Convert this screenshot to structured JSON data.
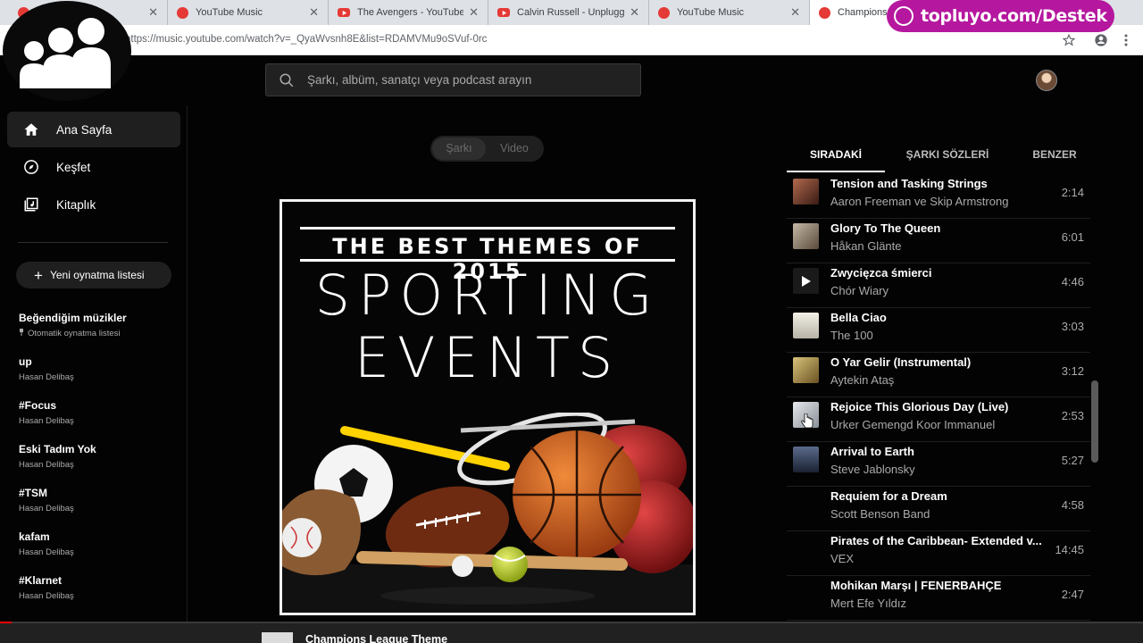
{
  "browser": {
    "tabs": [
      {
        "title": "",
        "icon": "youtube-music"
      },
      {
        "title": "YouTube Music",
        "icon": "youtube-music"
      },
      {
        "title": "The Avengers - YouTube",
        "icon": "youtube"
      },
      {
        "title": "Calvin Russell - Unplugged",
        "icon": "youtube"
      },
      {
        "title": "YouTube Music",
        "icon": "youtube-music"
      },
      {
        "title": "Champions",
        "icon": "youtube-music"
      }
    ],
    "url": "https://music.youtube.com/watch?v=_QyaWvsnh8E&list=RDAMVMu9oSVuf-0rc"
  },
  "overlay": {
    "banner_text": "topluyo.com/Destek"
  },
  "header": {
    "search_placeholder": "Şarkı, albüm, sanatçı veya podcast arayın"
  },
  "sidebar": {
    "nav": [
      {
        "label": "Ana Sayfa",
        "icon": "home-icon",
        "active": true
      },
      {
        "label": "Keşfet",
        "icon": "compass-icon",
        "active": false
      },
      {
        "label": "Kitaplık",
        "icon": "library-icon",
        "active": false
      }
    ],
    "new_playlist_label": "Yeni oynatma listesi",
    "playlists": [
      {
        "title": "Beğendiğim müzikler",
        "subtitle": "Otomatik oynatma listesi",
        "pinned": true
      },
      {
        "title": "up",
        "subtitle": "Hasan Delibaş"
      },
      {
        "title": "#Focus",
        "subtitle": "Hasan Delibaş"
      },
      {
        "title": "Eski Tadım Yok",
        "subtitle": "Hasan Delibaş"
      },
      {
        "title": "#TSM",
        "subtitle": "Hasan Delibaş"
      },
      {
        "title": "kafam",
        "subtitle": "Hasan Delibaş"
      },
      {
        "title": "#Klarnet",
        "subtitle": "Hasan Delibaş"
      }
    ]
  },
  "main": {
    "toggle": {
      "song_label": "Şarkı",
      "video_label": "Video"
    },
    "album_art": {
      "top_text": "THE BEST THEMES OF 2015",
      "line1": "SPORTING",
      "line2": "EVENTS"
    }
  },
  "queue": {
    "tabs": [
      "SIRADAKİ",
      "ŞARKI SÖZLERİ",
      "BENZER"
    ],
    "items": [
      {
        "title": "Tension and Tasking Strings",
        "artist": "Aaron Freeman ve Skip Armstrong",
        "duration": "2:14",
        "thumb": "#7a3a2e"
      },
      {
        "title": "Glory To The Queen",
        "artist": "Håkan Glänte",
        "duration": "6:01",
        "thumb": "#8a7a66"
      },
      {
        "title": "Zwycięzca śmierci",
        "artist": "Chór Wiary",
        "duration": "4:46",
        "thumb": "play"
      },
      {
        "title": "Bella Ciao",
        "artist": "The 100",
        "duration": "3:03",
        "thumb": "#e8e4da"
      },
      {
        "title": "O Yar Gelir (Instrumental)",
        "artist": "Aytekin Ataş",
        "duration": "3:12",
        "thumb": "#a88a4a"
      },
      {
        "title": "Rejoice This Glorious Day (Live)",
        "artist": "Urker Gemengd Koor Immanuel",
        "duration": "2:53",
        "thumb": "#c9cdd2"
      },
      {
        "title": "Arrival to Earth",
        "artist": "Steve Jablonsky",
        "duration": "5:27",
        "thumb": "#3a4a66"
      },
      {
        "title": "Requiem for a Dream",
        "artist": "Scott Benson Band",
        "duration": "4:58",
        "thumb": "none"
      },
      {
        "title": "Pirates of the Caribbean- Extended v...",
        "artist": "VEX",
        "duration": "14:45",
        "thumb": "none"
      },
      {
        "title": "Mohikan Marşı | FENERBAHÇE",
        "artist": "Mert Efe Yıldız",
        "duration": "2:47",
        "thumb": "none"
      }
    ]
  },
  "player": {
    "title": "Champions League Theme",
    "progress_fraction": 0.01
  },
  "colors": {
    "accent": "#ff0000",
    "background": "#030303",
    "overlay_banner": "#b5179e"
  }
}
